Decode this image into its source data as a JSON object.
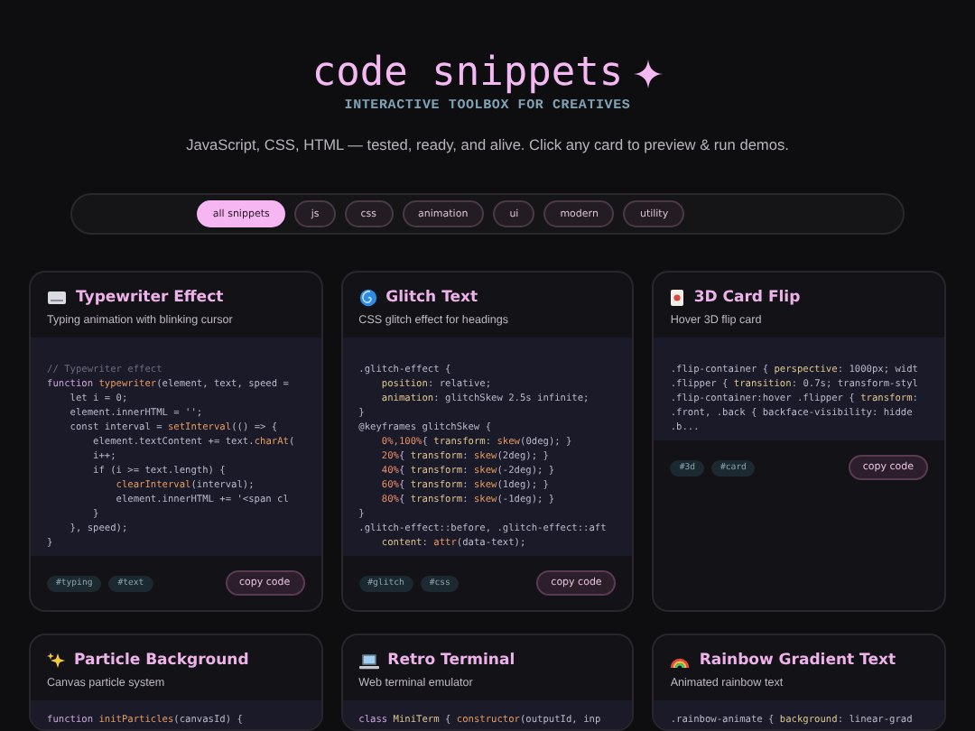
{
  "header": {
    "title": "code snippets",
    "subtitle": "INTERACTIVE TOOLBOX FOR CREATIVES",
    "description": "JavaScript, CSS, HTML — tested, ready, and alive. Click any card to preview & run demos."
  },
  "filters": [
    {
      "label": "all snippets",
      "selected": true
    },
    {
      "label": "js",
      "selected": false
    },
    {
      "label": "css",
      "selected": false
    },
    {
      "label": "animation",
      "selected": false
    },
    {
      "label": "ui",
      "selected": false
    },
    {
      "label": "modern",
      "selected": false
    },
    {
      "label": "utility",
      "selected": false
    }
  ],
  "cards": [
    {
      "title": "Typewriter Effect",
      "description": "Typing animation with blinking cursor",
      "code": [
        [
          {
            "text": "// Typewriter effect",
            "kind": "comment"
          }
        ],
        [
          {
            "text": "function ",
            "kind": "keyword"
          },
          {
            "text": "typewriter",
            "kind": "fn"
          },
          {
            "text": "(element, text, speed =",
            "kind": "plain"
          }
        ],
        [
          {
            "text": "    let i = 0;",
            "kind": "plain"
          }
        ],
        [
          {
            "text": "    element.innerHTML = '';",
            "kind": "plain"
          }
        ],
        [
          {
            "text": "    const interval = ",
            "kind": "plain"
          },
          {
            "text": "setInterval",
            "kind": "fn"
          },
          {
            "text": "(() => {",
            "kind": "plain"
          }
        ],
        [
          {
            "text": "        element.textContent += text.",
            "kind": "plain"
          },
          {
            "text": "charAt",
            "kind": "fn"
          },
          {
            "text": "(",
            "kind": "plain"
          }
        ],
        [
          {
            "text": "        i++;",
            "kind": "plain"
          }
        ],
        [
          {
            "text": "        if (i >= text.length) {",
            "kind": "plain"
          }
        ],
        [
          {
            "text": "            clearInterval",
            "kind": "fn"
          },
          {
            "text": "(interval);",
            "kind": "plain"
          }
        ],
        [
          {
            "text": "            element.innerHTML += '<span cl",
            "kind": "plain"
          }
        ],
        [
          {
            "text": "        }",
            "kind": "plain"
          }
        ],
        [
          {
            "text": "    }, speed);",
            "kind": "plain"
          }
        ],
        [
          {
            "text": "}",
            "kind": "plain"
          }
        ]
      ],
      "tags": [
        "#typing",
        "#text"
      ],
      "button": "copy code"
    },
    {
      "title": "Glitch Text",
      "description": "CSS glitch effect for headings",
      "code": [
        [
          {
            "text": ".glitch-effect {",
            "kind": "plain"
          }
        ],
        [
          {
            "text": "    position",
            "kind": "prop"
          },
          {
            "text": ": relative;",
            "kind": "plain"
          }
        ],
        [
          {
            "text": "    animation",
            "kind": "prop"
          },
          {
            "text": ": glitchSkew 2.5s infinite;",
            "kind": "plain"
          }
        ],
        [
          {
            "text": "}",
            "kind": "plain"
          }
        ],
        [
          {
            "text": "@keyframes glitchSkew {",
            "kind": "plain"
          }
        ],
        [
          {
            "text": "    0%,100%",
            "kind": "num"
          },
          {
            "text": "{ ",
            "kind": "plain"
          },
          {
            "text": "transform",
            "kind": "prop"
          },
          {
            "text": ": ",
            "kind": "plain"
          },
          {
            "text": "skew",
            "kind": "fn"
          },
          {
            "text": "(0deg); }",
            "kind": "plain"
          }
        ],
        [
          {
            "text": "    20%",
            "kind": "num"
          },
          {
            "text": "{ ",
            "kind": "plain"
          },
          {
            "text": "transform",
            "kind": "prop"
          },
          {
            "text": ": ",
            "kind": "plain"
          },
          {
            "text": "skew",
            "kind": "fn"
          },
          {
            "text": "(2deg); }",
            "kind": "plain"
          }
        ],
        [
          {
            "text": "    40%",
            "kind": "num"
          },
          {
            "text": "{ ",
            "kind": "plain"
          },
          {
            "text": "transform",
            "kind": "prop"
          },
          {
            "text": ": ",
            "kind": "plain"
          },
          {
            "text": "skew",
            "kind": "fn"
          },
          {
            "text": "(-2deg); }",
            "kind": "plain"
          }
        ],
        [
          {
            "text": "    60%",
            "kind": "num"
          },
          {
            "text": "{ ",
            "kind": "plain"
          },
          {
            "text": "transform",
            "kind": "prop"
          },
          {
            "text": ": ",
            "kind": "plain"
          },
          {
            "text": "skew",
            "kind": "fn"
          },
          {
            "text": "(1deg); }",
            "kind": "plain"
          }
        ],
        [
          {
            "text": "    80%",
            "kind": "num"
          },
          {
            "text": "{ ",
            "kind": "plain"
          },
          {
            "text": "transform",
            "kind": "prop"
          },
          {
            "text": ": ",
            "kind": "plain"
          },
          {
            "text": "skew",
            "kind": "fn"
          },
          {
            "text": "(-1deg); }",
            "kind": "plain"
          }
        ],
        [
          {
            "text": "}",
            "kind": "plain"
          }
        ],
        [
          {
            "text": ".glitch-effect::before, .glitch-effect::aft",
            "kind": "plain"
          }
        ],
        [
          {
            "text": "    content",
            "kind": "prop"
          },
          {
            "text": ": ",
            "kind": "plain"
          },
          {
            "text": "attr",
            "kind": "fn"
          },
          {
            "text": "(data-text);",
            "kind": "plain"
          }
        ]
      ],
      "tags": [
        "#glitch",
        "#css"
      ],
      "button": "copy code"
    },
    {
      "title": "3D Card Flip",
      "description": "Hover 3D flip card",
      "code": [
        [
          {
            "text": ".flip-container { ",
            "kind": "plain"
          },
          {
            "text": "perspective",
            "kind": "prop"
          },
          {
            "text": ": 1000px; widt",
            "kind": "plain"
          }
        ],
        [
          {
            "text": ".flipper { ",
            "kind": "plain"
          },
          {
            "text": "transition",
            "kind": "prop"
          },
          {
            "text": ": 0.7s; transform-styl",
            "kind": "plain"
          }
        ],
        [
          {
            "text": ".flip-container:hover .flipper { ",
            "kind": "plain"
          },
          {
            "text": "transform",
            "kind": "prop"
          },
          {
            "text": ":",
            "kind": "plain"
          }
        ],
        [
          {
            "text": ".front, .back { backface-visibility: hidde",
            "kind": "plain"
          }
        ],
        [
          {
            "text": ".b...",
            "kind": "plain"
          }
        ]
      ],
      "tags": [
        "#3d",
        "#card"
      ],
      "button": "copy code"
    },
    {
      "title": "Particle Background",
      "description": "Canvas particle system",
      "code": [
        [
          {
            "text": "function ",
            "kind": "keyword"
          },
          {
            "text": "initParticles",
            "kind": "fn"
          },
          {
            "text": "(canvasId) {",
            "kind": "plain"
          }
        ]
      ]
    },
    {
      "title": "Retro Terminal",
      "description": "Web terminal emulator",
      "code": [
        [
          {
            "text": "class ",
            "kind": "keyword"
          },
          {
            "text": "MiniTerm",
            "kind": "prop"
          },
          {
            "text": " { ",
            "kind": "plain"
          },
          {
            "text": "constructor",
            "kind": "fn"
          },
          {
            "text": "(outputId, inp",
            "kind": "plain"
          }
        ]
      ]
    },
    {
      "title": "Rainbow Gradient Text",
      "description": "Animated rainbow text",
      "code": [
        [
          {
            "text": ".rainbow-animate { ",
            "kind": "plain"
          },
          {
            "text": "background",
            "kind": "prop"
          },
          {
            "text": ": linear-grad",
            "kind": "plain"
          }
        ]
      ]
    }
  ]
}
